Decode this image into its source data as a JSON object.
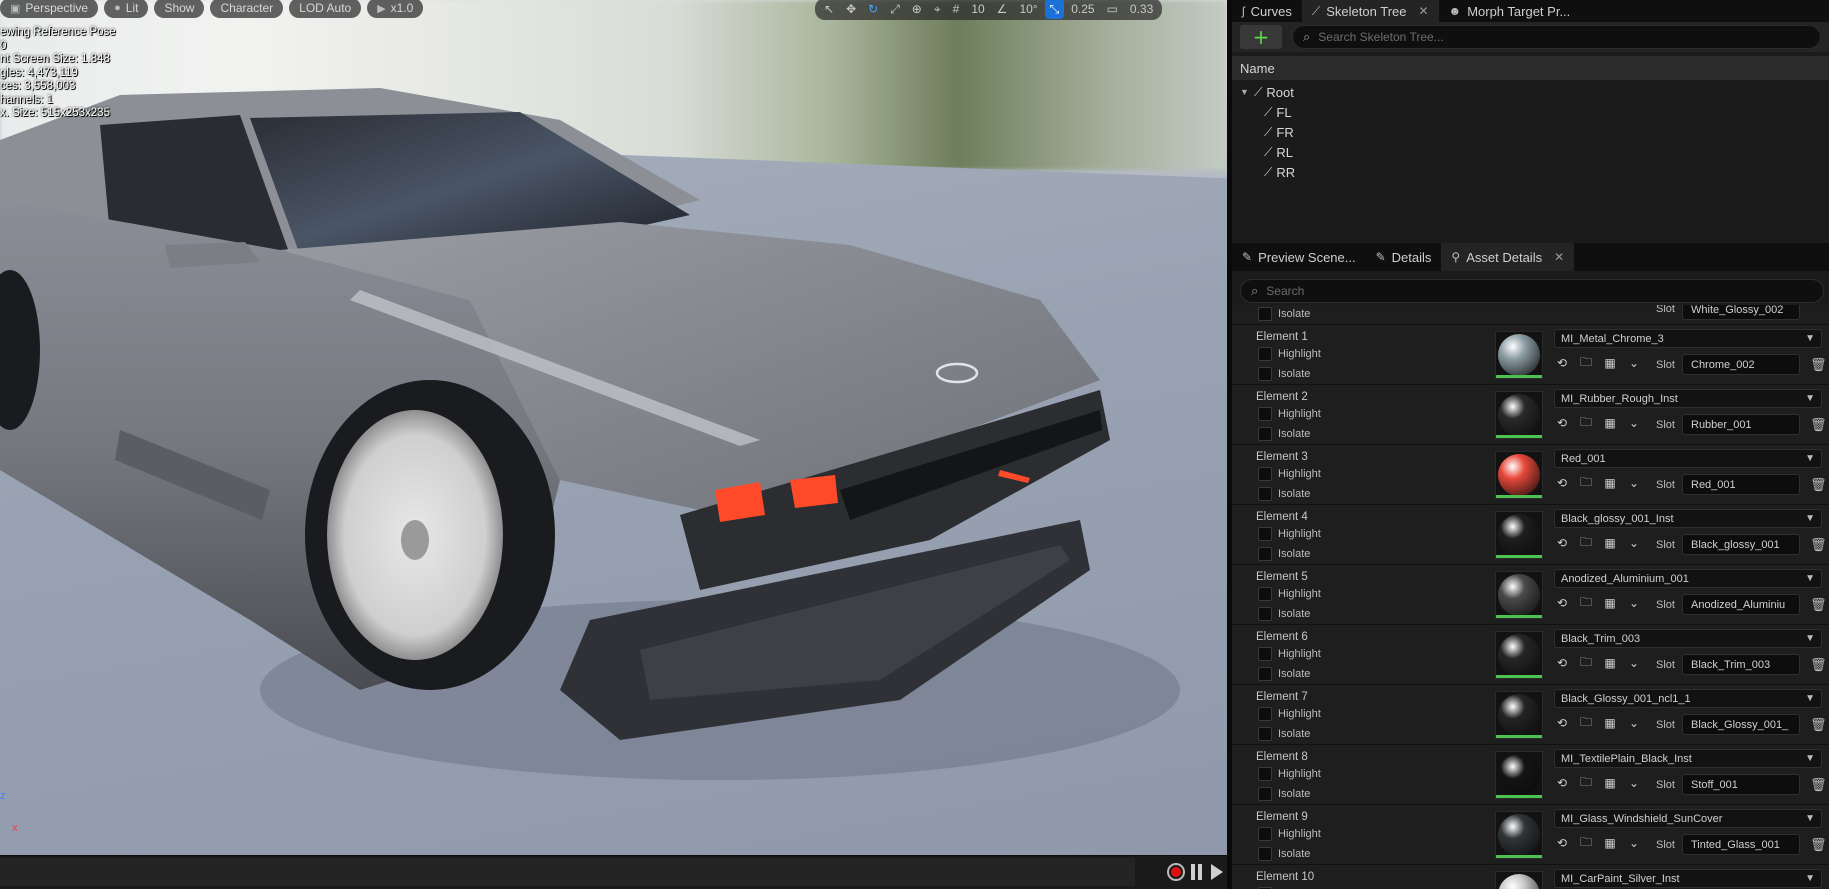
{
  "viewport": {
    "toolbar": {
      "perspective": "Perspective",
      "lit": "Lit",
      "show": "Show",
      "character": "Character",
      "lod": "LOD Auto",
      "speed": "x1.0",
      "grid": "10",
      "angle": "10°",
      "scale": "0.25",
      "camera_speed": "0.33"
    },
    "stats": [
      "ewing Reference Pose",
      "0",
      "nt Screen Size: 1.848",
      "gles: 4,473,119",
      "ces: 3,558,003",
      "hannels: 1",
      "x. Size: 515x253x235"
    ],
    "axis": {
      "z": "z",
      "x": "x"
    }
  },
  "skeleton_panel": {
    "tabs": [
      {
        "label": "Curves",
        "icon": "curve-icon"
      },
      {
        "label": "Skeleton Tree",
        "icon": "bone-icon",
        "active": true
      },
      {
        "label": "Morph Target Pr...",
        "icon": "morph-icon"
      }
    ],
    "search_placeholder": "Search Skeleton Tree...",
    "header": "Name",
    "bones": [
      {
        "label": "Root",
        "depth": 0
      },
      {
        "label": "FL",
        "depth": 1
      },
      {
        "label": "FR",
        "depth": 1
      },
      {
        "label": "RL",
        "depth": 1
      },
      {
        "label": "RR",
        "depth": 1
      }
    ]
  },
  "asset_panel": {
    "tabs": [
      {
        "label": "Preview Scene...",
        "icon": "pencil-icon"
      },
      {
        "label": "Details",
        "icon": "pencil-icon"
      },
      {
        "label": "Asset Details",
        "icon": "wand-icon",
        "active": true
      }
    ],
    "search_placeholder": "Search",
    "highlight_label": "Highlight",
    "isolate_label": "Isolate",
    "slot_label": "Slot",
    "partial_top": {
      "isolate": "Isolate",
      "slot_value": "White_Glossy_002"
    },
    "elements": [
      {
        "name": "Element 1",
        "material": "MI_Metal_Chrome_3",
        "slot": "Chrome_002",
        "color": "#8fa0a8"
      },
      {
        "name": "Element 2",
        "material": "MI_Rubber_Rough_Inst",
        "slot": "Rubber_001",
        "color": "#2a2a2a"
      },
      {
        "name": "Element 3",
        "material": "Red_001",
        "slot": "Red_001",
        "color": "#e8483a"
      },
      {
        "name": "Element 4",
        "material": "Black_glossy_001_Inst",
        "slot": "Black_glossy_001",
        "color": "#1e1e1e"
      },
      {
        "name": "Element 5",
        "material": "Anodized_Aluminium_001",
        "slot": "Anodized_Aluminiu",
        "color": "#4a4a4a"
      },
      {
        "name": "Element 6",
        "material": "Black_Trim_003",
        "slot": "Black_Trim_003",
        "color": "#262626"
      },
      {
        "name": "Element 7",
        "material": "Black_Glossy_001_ncl1_1",
        "slot": "Black_Glossy_001_",
        "color": "#242424"
      },
      {
        "name": "Element 8",
        "material": "MI_TextilePlain_Black_Inst",
        "slot": "Stoff_001",
        "color": "#141414"
      },
      {
        "name": "Element 9",
        "material": "MI_Glass_Windshield_SunCover",
        "slot": "Tinted_Glass_001",
        "color": "#303538"
      },
      {
        "name": "Element 10",
        "material": "MI_CarPaint_Silver_Inst",
        "slot": "",
        "color": "#c8c8c8"
      }
    ]
  }
}
